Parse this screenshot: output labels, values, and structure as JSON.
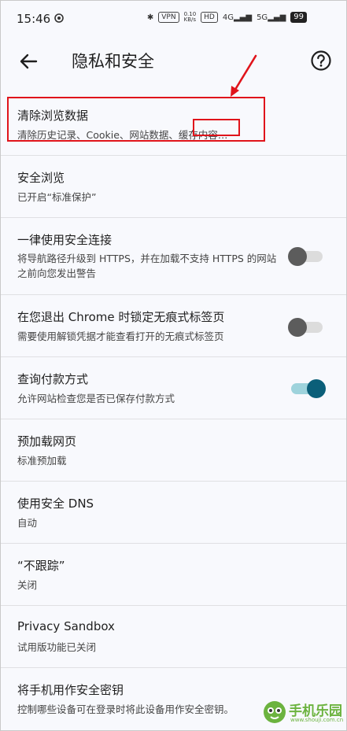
{
  "status_bar": {
    "time": "15:46",
    "vpn": "VPN",
    "speed": "0.10\nKB/s",
    "hd": "HD",
    "net1": "4G",
    "net2": "5G",
    "battery": "99"
  },
  "header": {
    "title": "隐私和安全",
    "back_icon": "arrow-left-icon",
    "help_icon": "help-circle-icon"
  },
  "items": [
    {
      "title": "清除浏览数据",
      "subtitle": "清除历史记录、Cookie、网站数据、缓存内容…"
    },
    {
      "title": "安全浏览",
      "subtitle": "已开启“标准保护”"
    },
    {
      "title": "一律使用安全连接",
      "subtitle": "将导航路径升级到 HTTPS，并在加载不支持 HTTPS 的网站之前向您发出警告",
      "toggle": false
    },
    {
      "title": "在您退出 Chrome 时锁定无痕式标签页",
      "subtitle": "需要使用解锁凭据才能查看打开的无痕式标签页",
      "toggle": false
    },
    {
      "title": "查询付款方式",
      "subtitle": "允许网站检查您是否已保存付款方式",
      "toggle": true
    },
    {
      "title": "预加载网页",
      "subtitle": "标准预加载"
    },
    {
      "title": "使用安全 DNS",
      "subtitle": "自动"
    },
    {
      "title": "“不跟踪”",
      "subtitle": "关闭"
    },
    {
      "title": "Privacy Sandbox",
      "subtitle": "试用版功能已关闭"
    },
    {
      "title": "将手机用作安全密钥",
      "subtitle": "控制哪些设备可在登录时将此设备用作安全密钥。"
    }
  ],
  "watermark": {
    "text": "手机乐园",
    "url": "www.shouji.com.cn"
  },
  "colors": {
    "accent": "#0b5f79",
    "annotation": "#e0141b",
    "watermark": "#6cb33f"
  }
}
